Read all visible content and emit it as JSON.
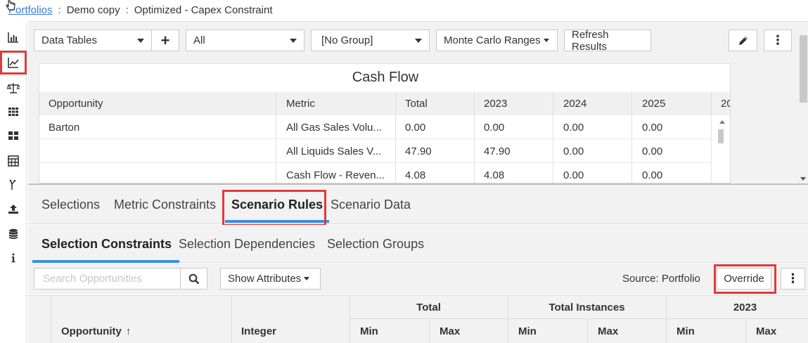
{
  "breadcrumb": {
    "root": "Portfolios",
    "sep": ":",
    "item1": "Demo copy",
    "item2": "Optimized - Capex Constraint"
  },
  "leftnav": {
    "items": [
      {
        "icon": "bar-chart-icon"
      },
      {
        "icon": "line-chart-icon",
        "active": true
      },
      {
        "icon": "scale-icon"
      },
      {
        "icon": "grid-icon"
      },
      {
        "icon": "dashboard-icon"
      },
      {
        "icon": "calculator-icon"
      },
      {
        "icon": "branch-icon"
      },
      {
        "icon": "upload-icon"
      },
      {
        "icon": "database-icon"
      },
      {
        "icon": "info-icon"
      }
    ]
  },
  "toolbar": {
    "view_select": "Data Tables",
    "add_label": "+",
    "filter_select": "All",
    "group_select": "[No Group]",
    "ranges_label": "Monte Carlo Ranges",
    "refresh_label": "Refresh Results",
    "more_label": "⋮"
  },
  "cashflow": {
    "title": "Cash Flow",
    "columns": [
      "Opportunity",
      "Metric",
      "Total",
      "2023",
      "2024",
      "2025",
      "20"
    ],
    "rows": [
      [
        "Barton",
        "All Gas Sales Volu...",
        "0.00",
        "0.00",
        "0.00",
        "0.00"
      ],
      [
        "",
        "All Liquids Sales V...",
        "47.90",
        "47.90",
        "0.00",
        "0.00"
      ],
      [
        "",
        "Cash Flow - Reven...",
        "4.08",
        "4.08",
        "0.00",
        "0.00"
      ]
    ]
  },
  "main_tabs": {
    "selections": "Selections",
    "metric_constraints": "Metric Constraints",
    "scenario_rules": "Scenario Rules",
    "scenario_data": "Scenario Data"
  },
  "sub_tabs": {
    "selection_constraints": "Selection Constraints",
    "selection_dependencies": "Selection Dependencies",
    "selection_groups": "Selection Groups"
  },
  "constraints_toolbar": {
    "search_placeholder": "Search Opportunities",
    "show_attributes": "Show Attributes",
    "source": "Source: Portfolio",
    "override": "Override",
    "more_label": "⋮"
  },
  "constraints_table": {
    "groups": [
      "Total",
      "Total Instances",
      "2023"
    ],
    "opportunity_header": "Opportunity",
    "sort_arrow": "↑",
    "integer_header": "Integer",
    "min_label": "Min",
    "max_label": "Max"
  },
  "colors": {
    "accent": "#3a8ee6",
    "highlight": "#e23a3a",
    "link": "#3a7bd5"
  }
}
